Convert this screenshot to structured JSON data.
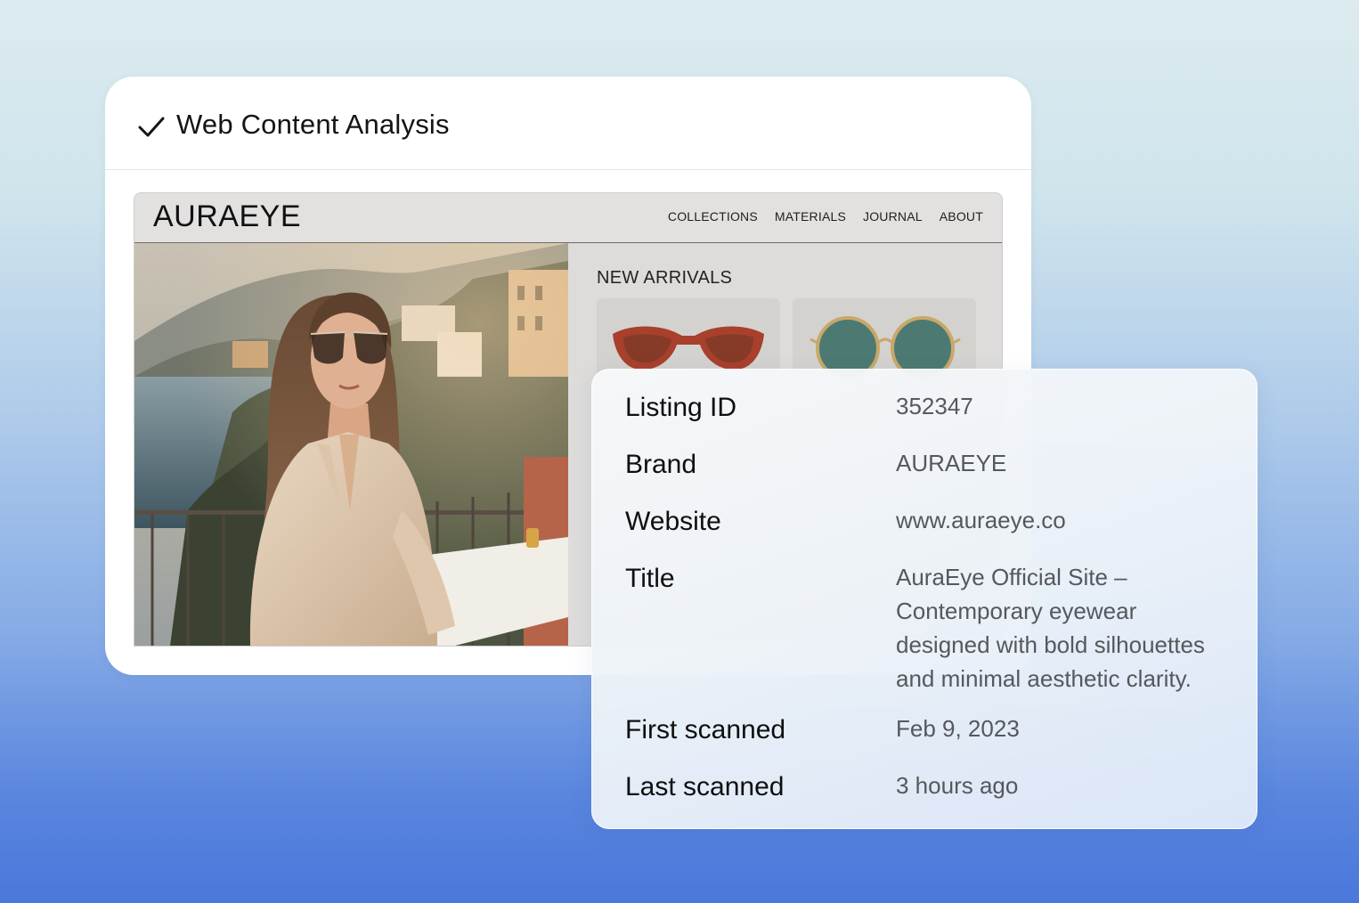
{
  "card": {
    "title": "Web Content Analysis"
  },
  "site": {
    "logo": "AURAEYE",
    "nav": [
      "COLLECTIONS",
      "MATERIALS",
      "JOURNAL",
      "ABOUT"
    ],
    "section_title": "NEW ARRIVALS"
  },
  "info": {
    "rows": [
      {
        "label": "Listing ID",
        "value": "352347"
      },
      {
        "label": "Brand",
        "value": "AURAEYE"
      },
      {
        "label": "Website",
        "value": "www.auraeye.co"
      },
      {
        "label": "Title",
        "lines": [
          "AuraEye Official Site –",
          "Contemporary eyewear",
          "designed with bold silhouettes",
          "and minimal aesthetic clarity."
        ]
      },
      {
        "label": "First scanned",
        "value": "Feb 9, 2023"
      },
      {
        "label": "Last scanned",
        "value": "3 hours ago"
      }
    ]
  },
  "colors": {
    "accent_text": "#141414",
    "value_text": "#55585c",
    "lens_red": "#a8402c",
    "lens_teal": "#4c7a72"
  }
}
